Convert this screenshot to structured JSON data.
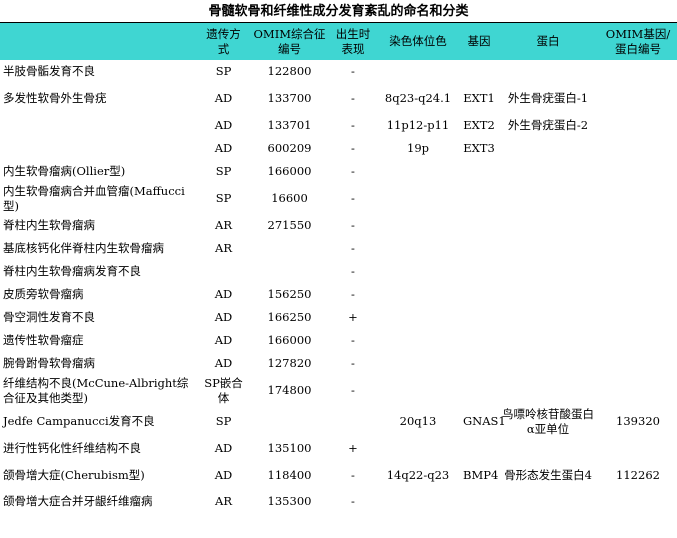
{
  "title": "骨髓软骨和纤维性成分发育紊乱的命名和分类",
  "headers": [
    "",
    "遗传方式",
    "OMIM综合征编号",
    "出生时表现",
    "染色体位色",
    "基因",
    "蛋白",
    "OMIM基因/蛋白编号"
  ],
  "rows": [
    {
      "name": "半肢骨骺发育不良",
      "inherit": "SP",
      "omim": "122800",
      "birth": "-",
      "chrom": "",
      "gene": "",
      "protein": "",
      "gene_omim": ""
    },
    {
      "name": "多发性软骨外生骨疣",
      "inherit": "AD",
      "omim": "133700",
      "birth": "-",
      "chrom": "8q23-q24.1",
      "gene": "EXT1",
      "protein": "外生骨疣蛋白-1",
      "gene_omim": ""
    },
    {
      "name": "",
      "inherit": "AD",
      "omim": "133701",
      "birth": "-",
      "chrom": "11p12-p11",
      "gene": "EXT2",
      "protein": "外生骨疣蛋白-2",
      "gene_omim": ""
    },
    {
      "name": "",
      "inherit": "AD",
      "omim": "600209",
      "birth": "-",
      "chrom": "19p",
      "gene": "EXT3",
      "protein": "",
      "gene_omim": ""
    },
    {
      "name": "内生软骨瘤病(Ollier型)",
      "inherit": "SP",
      "omim": "166000",
      "birth": "-",
      "chrom": "",
      "gene": "",
      "protein": "",
      "gene_omim": ""
    },
    {
      "name": "内生软骨瘤病合并血管瘤(Maffucci型)",
      "inherit": "SP",
      "omim": "16600",
      "birth": "-",
      "chrom": "",
      "gene": "",
      "protein": "",
      "gene_omim": ""
    },
    {
      "name": "脊柱内生软骨瘤病",
      "inherit": "AR",
      "omim": "271550",
      "birth": "-",
      "chrom": "",
      "gene": "",
      "protein": "",
      "gene_omim": ""
    },
    {
      "name": "基底核钙化伴脊柱内生软骨瘤病",
      "inherit": "AR",
      "omim": "",
      "birth": "-",
      "chrom": "",
      "gene": "",
      "protein": "",
      "gene_omim": ""
    },
    {
      "name": "脊柱内生软骨瘤病发育不良",
      "inherit": "",
      "omim": "",
      "birth": "-",
      "chrom": "",
      "gene": "",
      "protein": "",
      "gene_omim": ""
    },
    {
      "name": "皮质旁软骨瘤病",
      "inherit": "AD",
      "omim": "156250",
      "birth": "-",
      "chrom": "",
      "gene": "",
      "protein": "",
      "gene_omim": ""
    },
    {
      "name": "骨空洞性发育不良",
      "inherit": "AD",
      "omim": "166250",
      "birth": "+",
      "chrom": "",
      "gene": "",
      "protein": "",
      "gene_omim": ""
    },
    {
      "name": "遗传性软骨瘤症",
      "inherit": "AD",
      "omim": "166000",
      "birth": "-",
      "chrom": "",
      "gene": "",
      "protein": "",
      "gene_omim": ""
    },
    {
      "name": "腕骨跗骨软骨瘤病",
      "inherit": "AD",
      "omim": "127820",
      "birth": "-",
      "chrom": "",
      "gene": "",
      "protein": "",
      "gene_omim": ""
    },
    {
      "name": "纤维结构不良(McCune-Albright综合征及其他类型)",
      "inherit": "SP嵌合体",
      "omim": "174800",
      "birth": "-",
      "chrom": "",
      "gene": "",
      "protein": "",
      "gene_omim": ""
    },
    {
      "name": "Jedfe Campanucci发育不良",
      "inherit": "SP",
      "omim": "",
      "birth": "",
      "chrom": "20q13",
      "gene": "GNAS1",
      "protein": "鸟嘌呤核苷酸蛋白α亚单位",
      "gene_omim": "139320"
    },
    {
      "name": "进行性钙化性纤维结构不良",
      "inherit": "AD",
      "omim": "135100",
      "birth": "+",
      "chrom": "",
      "gene": "",
      "protein": "",
      "gene_omim": ""
    },
    {
      "name": "颌骨增大症(Cherubism型)",
      "inherit": "AD",
      "omim": "118400",
      "birth": "-",
      "chrom": "14q22-q23",
      "gene": "BMP4",
      "protein": "骨形态发生蛋白4",
      "gene_omim": "112262"
    },
    {
      "name": "颌骨增大症合并牙龈纤维瘤病",
      "inherit": "AR",
      "omim": "135300",
      "birth": "-",
      "chrom": "",
      "gene": "",
      "protein": "",
      "gene_omim": ""
    }
  ]
}
